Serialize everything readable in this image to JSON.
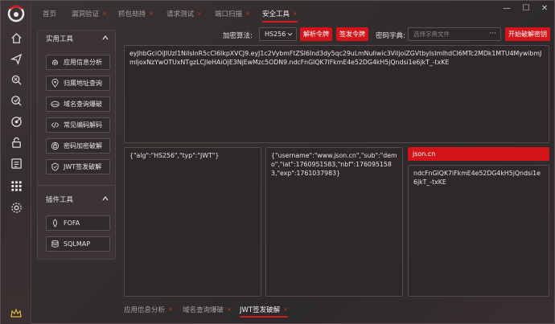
{
  "tabs": [
    {
      "label": "首页",
      "closable": false
    },
    {
      "label": "漏洞验证",
      "closable": true
    },
    {
      "label": "抓包劫持",
      "closable": true
    },
    {
      "label": "请求测试",
      "closable": true
    },
    {
      "label": "端口扫描",
      "closable": true
    },
    {
      "label": "安全工具",
      "closable": true,
      "active": true
    }
  ],
  "tab_close_glyph": "×",
  "window_controls": {
    "minimize": "—",
    "maximize": "☐",
    "close": "✕"
  },
  "rail_icons": [
    "home-icon",
    "send-icon",
    "bug-search-icon",
    "scan-icon",
    "target-icon",
    "unlock-icon",
    "list-icon",
    "apps-grid-icon",
    "settings-icon"
  ],
  "tools_panel": {
    "section1": {
      "title": "实用工具",
      "items": [
        {
          "label": "应用信息分析",
          "icon": "fingerprint-icon"
        },
        {
          "label": "归属地址查询",
          "icon": "location-pin-icon"
        },
        {
          "label": "域名查询爆破",
          "icon": "www-icon"
        },
        {
          "label": "常见编码解码",
          "icon": "code-icon"
        },
        {
          "label": "密码加密破解",
          "icon": "key-icon"
        },
        {
          "label": "JWT签发破解",
          "icon": "jwt-icon"
        }
      ]
    },
    "section2": {
      "title": "插件工具",
      "items": [
        {
          "label": "FOFA",
          "icon": "fofa-icon"
        },
        {
          "label": "SQLMAP",
          "icon": "sqlmap-icon"
        }
      ]
    }
  },
  "controls": {
    "algorithm_label": "加密算法:",
    "algorithm_value": "HS256",
    "parse_button": "解析令牌",
    "sign_button": "签发令牌",
    "dict_label": "密码字典:",
    "dict_placeholder": "选择字典文件",
    "dict_browse": "···",
    "crack_button": "开始破解密钥"
  },
  "token": "eyJhbGciOiJIUzI1NiIsInR5cCI6IkpXVCJ9.eyJ1c2VybmFtZSI6Ind3dy5qc29uLmNuIiwic3ViIjoiZGVtbyIsImlhdCI6MTc2MDk1MTU4MywibmJmIjoxNzYwOTUxNTgzLCJleHAiOjE3NjEwMzc5ODN9.ndcFnGlQK7lFkmE4e52DG4kH5jQndsi1e6jkT_-txKE",
  "header_json": "{\"alg\":\"HS256\",\"typ\":\"JWT\"}",
  "payload_json": "{\"username\":\"www.json.cn\",\"sub\":\"demo\",\"iat\":1760951583,\"nbf\":1760951583,\"exp\":1761037983}",
  "secret_result": "json.cn",
  "signature": "ndcFnGlQK7lFkmE4e52DG4kH5jQndsi1e6jkT_-txKE",
  "bottom_tabs": [
    {
      "label": "应用信息分析",
      "closable": true
    },
    {
      "label": "域名查询爆破",
      "closable": true
    },
    {
      "label": "JWT签发破解",
      "closable": true,
      "active": true
    }
  ],
  "colors": {
    "accent": "#d3151b",
    "bg": "#332d2e"
  }
}
